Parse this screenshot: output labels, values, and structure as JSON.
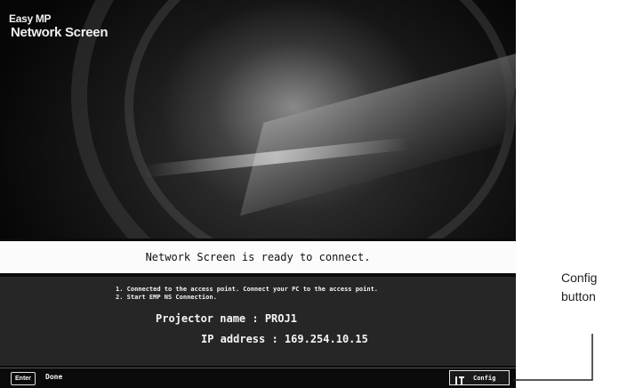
{
  "logo": {
    "line1": "Easy MP",
    "line2": "Network Screen"
  },
  "status": {
    "message": "Network Screen is ready to connect."
  },
  "instructions": [
    "1. Connected to the access point. Connect your PC to the access point.",
    "2. Start EMP NS Connection."
  ],
  "projector": {
    "name_line": "Projector name : PROJ1",
    "ip_line": "IP address : 169.254.10.15"
  },
  "bottom_bar": {
    "enter_key": "Enter",
    "done_label": "Done",
    "config_label": "Config"
  },
  "callout": {
    "line1": "Config",
    "line2": "button"
  }
}
